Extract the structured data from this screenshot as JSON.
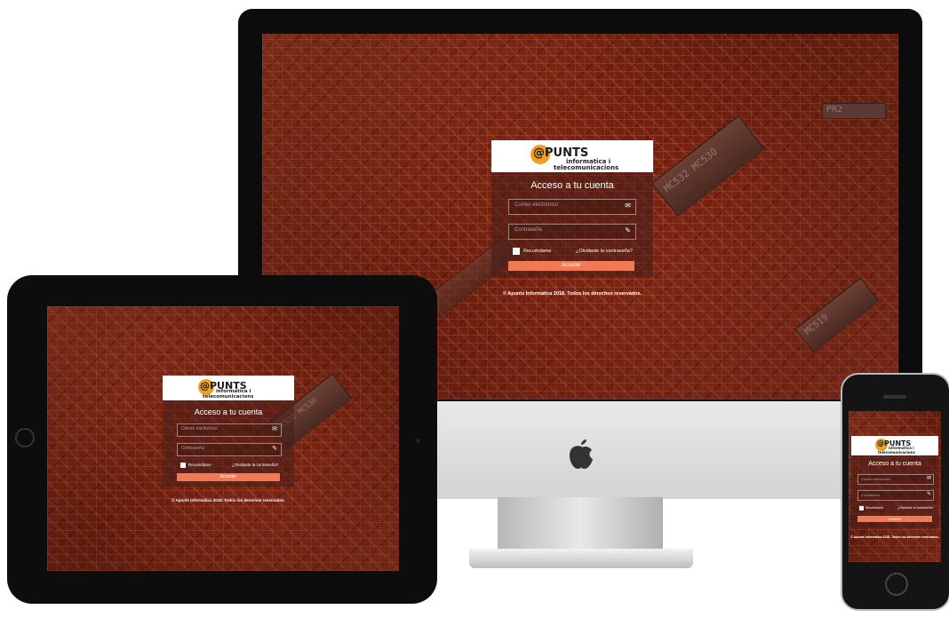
{
  "brand": {
    "logo_main": "@PUNTS",
    "logo_sub_1": "informatica i",
    "logo_sub_2": "telecomunicacions"
  },
  "login": {
    "title": "Acceso a tu cuenta",
    "email_placeholder": "Correo electrónico",
    "password_placeholder": "Contraseña",
    "remember_label": "Recuérdame",
    "forgot_link": "¿Olvidaste la contraseña?",
    "submit_label": "Acceder"
  },
  "footer": {
    "copyright": "© Apunts Informatica 2018. Todos los derechos reservados."
  },
  "icons": {
    "email": "envelope-icon",
    "password": "pencil-icon",
    "apple": "apple-logo-icon"
  },
  "colors": {
    "accent_button": "#f07a55",
    "logo_orange": "#f0a020",
    "screen_background": "#8a2a16"
  }
}
